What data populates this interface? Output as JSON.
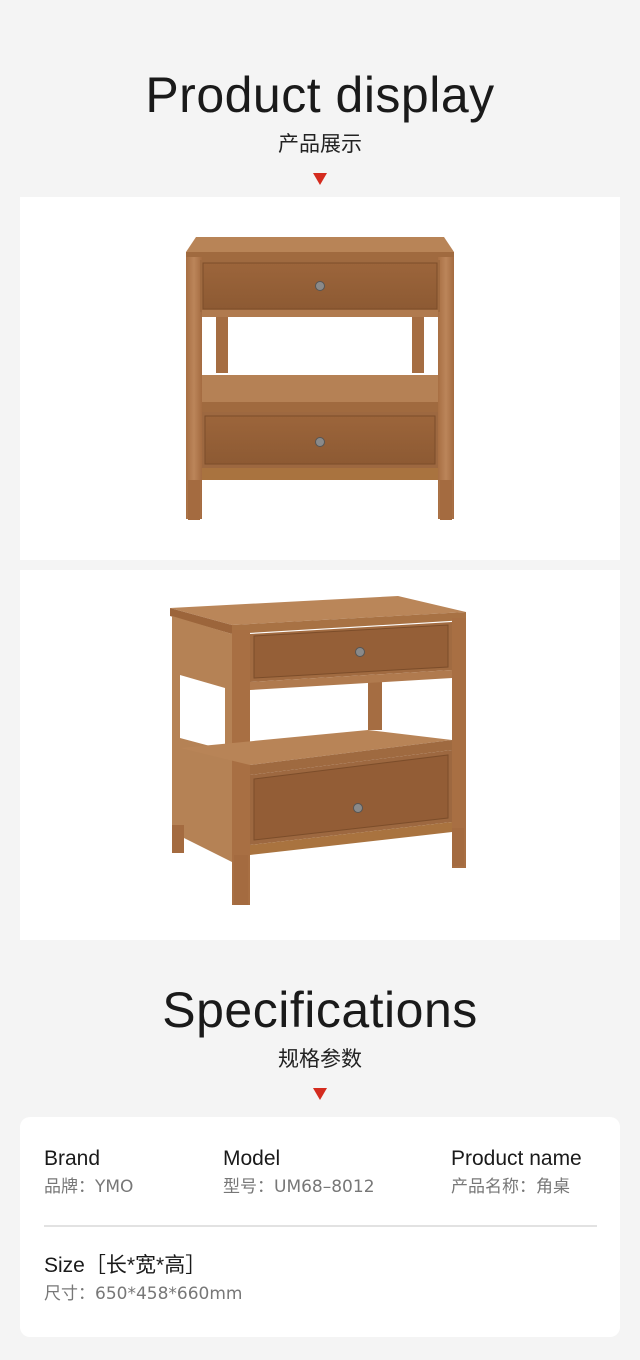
{
  "display_section": {
    "title_en": "Product display",
    "title_zh": "产品展示"
  },
  "photos": [
    {
      "subject": "nightstand-front-view"
    },
    {
      "subject": "nightstand-angled-view"
    }
  ],
  "spec_section": {
    "title_en": "Specifications",
    "title_zh": "规格参数"
  },
  "specs": {
    "brand": {
      "label": "Brand",
      "value": "品牌：YMO"
    },
    "model": {
      "label": "Model",
      "value": "型号：UM68–8012"
    },
    "name": {
      "label": "Product name",
      "value": "产品名称：角桌"
    },
    "size": {
      "label": "Size［长*宽*高］",
      "value": "尺寸：650*458*660mm"
    }
  },
  "colors": {
    "accent": "#d42b1e",
    "wood": "#b07a4e",
    "background": "#f4f4f4"
  }
}
